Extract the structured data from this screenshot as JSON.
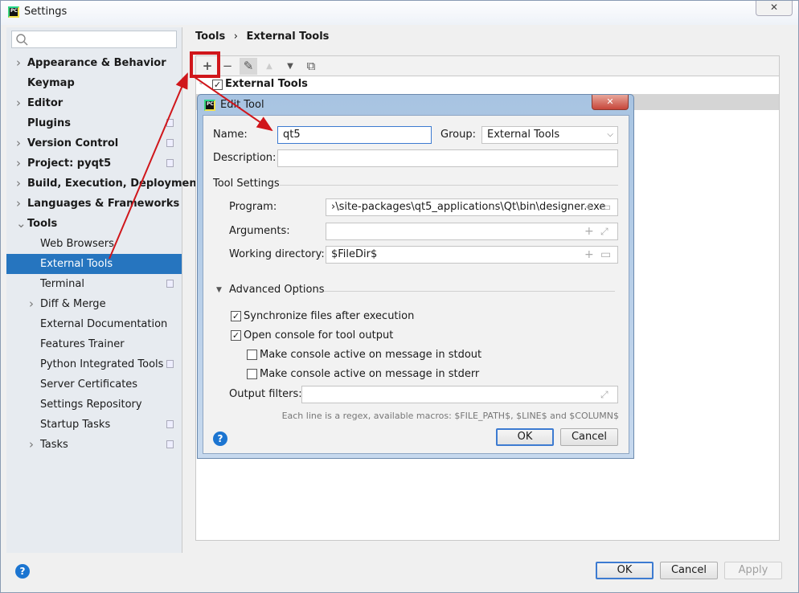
{
  "window": {
    "title": "Settings",
    "close": "✕"
  },
  "sidebar": {
    "search_placeholder": "",
    "items": [
      {
        "label": "Appearance & Behavior",
        "bold": true,
        "chevron": true
      },
      {
        "label": "Keymap",
        "bold": true
      },
      {
        "label": "Editor",
        "bold": true,
        "chevron": true
      },
      {
        "label": "Plugins",
        "bold": true,
        "copy": true
      },
      {
        "label": "Version Control",
        "bold": true,
        "chevron": true,
        "copy": true
      },
      {
        "label": "Project: pyqt5",
        "bold": true,
        "chevron": true,
        "copy": true
      },
      {
        "label": "Build, Execution, Deployment",
        "bold": true,
        "chevron": true
      },
      {
        "label": "Languages & Frameworks",
        "bold": true,
        "chevron": true
      },
      {
        "label": "Tools",
        "bold": true,
        "expanded": true
      },
      {
        "label": "Web Browsers",
        "indent": true
      },
      {
        "label": "External Tools",
        "indent": true,
        "selected": true
      },
      {
        "label": "Terminal",
        "indent": true,
        "copy": true
      },
      {
        "label": "Diff & Merge",
        "indent": true,
        "chevron": true
      },
      {
        "label": "External Documentation",
        "indent": true
      },
      {
        "label": "Features Trainer",
        "indent": true
      },
      {
        "label": "Python Integrated Tools",
        "indent": true,
        "copy": true
      },
      {
        "label": "Server Certificates",
        "indent": true
      },
      {
        "label": "Settings Repository",
        "indent": true
      },
      {
        "label": "Startup Tasks",
        "indent": true,
        "copy": true
      },
      {
        "label": "Tasks",
        "indent": true,
        "chevron": true,
        "copy": true
      }
    ]
  },
  "breadcrumb": {
    "parent": "Tools",
    "separator": "›",
    "current": "External Tools"
  },
  "toolbar": {
    "add": "+",
    "remove": "−",
    "edit": "✎",
    "up": "▲",
    "down": "▼",
    "copy": "⧉"
  },
  "list": {
    "group_label": "External Tools",
    "checked": true
  },
  "dialog": {
    "title": "Edit Tool",
    "close": "✕",
    "name_label": "Name:",
    "name_value": "qt5",
    "group_label": "Group:",
    "group_value": "External Tools",
    "description_label": "Description:",
    "description_value": "",
    "tool_settings_label": "Tool Settings",
    "program_label": "Program:",
    "program_value": "›\\site-packages\\qt5_applications\\Qt\\bin\\designer.exe",
    "arguments_label": "Arguments:",
    "arguments_value": "",
    "workdir_label": "Working directory:",
    "workdir_value": "$FileDir$",
    "advanced_label": "Advanced Options",
    "checkboxes": [
      {
        "label": "Synchronize files after execution",
        "checked": true
      },
      {
        "label": "Open console for tool output",
        "checked": true
      },
      {
        "label": "Make console active on message in stdout",
        "checked": false
      },
      {
        "label": "Make console active on message in stderr",
        "checked": false
      }
    ],
    "output_filters_label": "Output filters:",
    "output_filters_value": "",
    "hint": "Each line is a regex, available macros: $FILE_PATH$, $LINE$ and $COLUMN$",
    "ok": "OK",
    "cancel": "Cancel",
    "help": "?"
  },
  "footer": {
    "ok": "OK",
    "cancel": "Cancel",
    "apply": "Apply",
    "help": "?"
  },
  "colors": {
    "selection": "#2675bf",
    "annotation": "#d0161b",
    "help": "#1c75d1"
  }
}
